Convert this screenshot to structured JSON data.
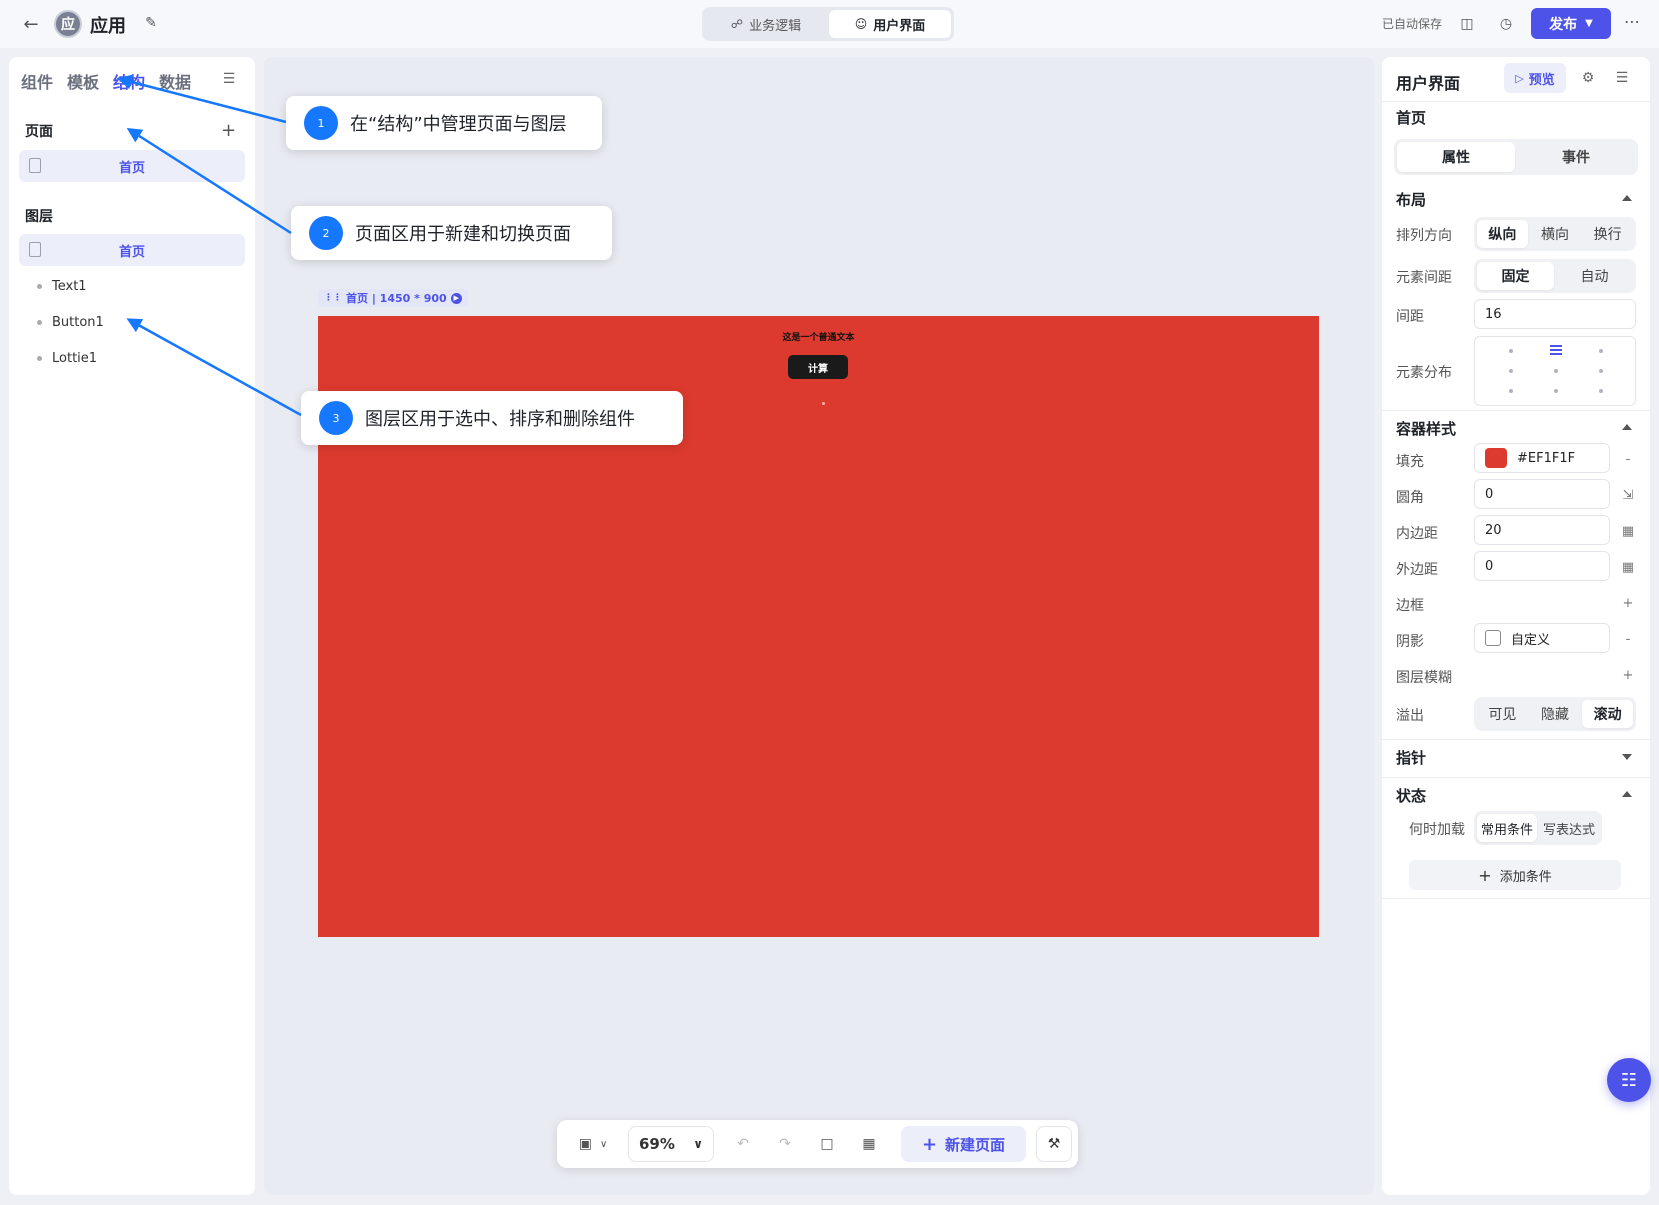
{
  "header": {
    "app_avatar": "应",
    "app_name": "应用",
    "tabs": [
      {
        "label": "业务逻辑",
        "icon": "share-icon"
      },
      {
        "label": "用户界面",
        "icon": "user-icon"
      }
    ],
    "autosave": "已自动保存",
    "publish_label": "发布"
  },
  "left_panel": {
    "tabs": [
      "组件",
      "模板",
      "结构",
      "数据"
    ],
    "active_tab": "结构",
    "pages_title": "页面",
    "pages": [
      "首页"
    ],
    "layers_title": "图层",
    "layers_root": "首页",
    "layers": [
      "Text1",
      "Button1",
      "Lottie1"
    ]
  },
  "canvas": {
    "frame_label": "首页 | 1450 * 900",
    "text": "这是一个普通文本",
    "button": "计算",
    "fill_color": "#DC3A2E"
  },
  "bottom_toolbar": {
    "zoom": "69%",
    "new_page": "新建页面"
  },
  "right_panel": {
    "title": "用户界面",
    "preview": "预览",
    "page_name": "首页",
    "tabs": [
      "属性",
      "事件"
    ],
    "layout": {
      "title": "布局",
      "direction_label": "排列方向",
      "direction_options": [
        "纵向",
        "横向",
        "换行"
      ],
      "spacing_label": "元素间距",
      "spacing_options": [
        "固定",
        "自动"
      ],
      "gap_label": "间距",
      "gap_value": "16",
      "distribution_label": "元素分布"
    },
    "container": {
      "title": "容器样式",
      "fill_label": "填充",
      "fill_value": "#EF1F1F",
      "radius_label": "圆角",
      "radius_value": "0",
      "padding_label": "内边距",
      "padding_value": "20",
      "margin_label": "外边距",
      "margin_value": "0",
      "border_label": "边框",
      "shadow_label": "阴影",
      "shadow_value": "自定义",
      "blur_label": "图层模糊",
      "overflow_label": "溢出",
      "overflow_options": [
        "可见",
        "隐藏",
        "滚动"
      ]
    },
    "pointer_title": "指针",
    "state": {
      "title": "状态",
      "load_label": "何时加载",
      "load_options": [
        "常用条件",
        "写表达式"
      ],
      "add_condition": "添加条件"
    }
  },
  "annotations": [
    {
      "num": "1",
      "text": "在“结构”中管理页面与图层"
    },
    {
      "num": "2",
      "text": "页面区用于新建和切换页面"
    },
    {
      "num": "3",
      "text": "图层区用于选中、排序和删除组件"
    }
  ],
  "colors": {
    "accent": "#4D53E8",
    "annotation": "#1677FF",
    "canvas_fill": "#DC3A2E"
  }
}
